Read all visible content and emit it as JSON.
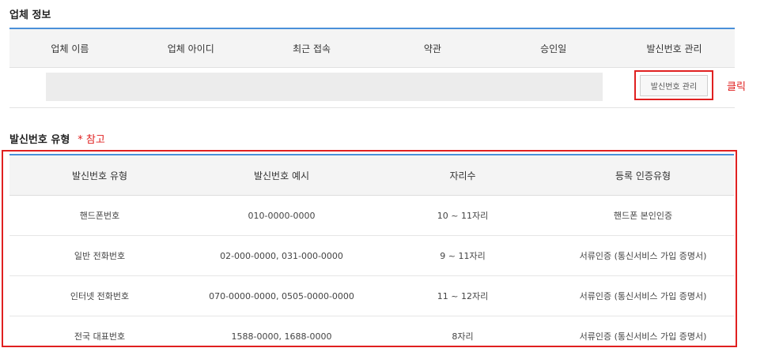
{
  "vendor_section": {
    "title": "업체 정보",
    "headers": [
      "업체 이름",
      "업체 아이디",
      "최근 접속",
      "약관",
      "승인일",
      "발신번호 관리"
    ],
    "manage_button_label": "발신번호 관리",
    "click_note": "클릭"
  },
  "type_section": {
    "title": "발신번호 유형",
    "note": "* 참고",
    "headers": [
      "발신번호 유형",
      "발신번호 예시",
      "자리수",
      "등록 인증유형"
    ],
    "rows": [
      [
        "핸드폰번호",
        "010-0000-0000",
        "10 ~ 11자리",
        "핸드폰 본인인증"
      ],
      [
        "일반 전화번호",
        "02-000-0000, 031-000-0000",
        "9 ~ 11자리",
        "서류인증 (통신서비스 가입 증명서)"
      ],
      [
        "인터넷 전화번호",
        "070-0000-0000, 0505-0000-0000",
        "11 ~ 12자리",
        "서류인증 (통신서비스 가입 증명서)"
      ],
      [
        "전국 대표번호",
        "1588-0000, 1688-0000",
        "8자리",
        "서류인증 (통신서비스 가입 증명서)"
      ]
    ]
  },
  "colors": {
    "accent_line": "#4a90d9",
    "highlight_red": "#e02020",
    "header_bg": "#f4f4f4"
  }
}
